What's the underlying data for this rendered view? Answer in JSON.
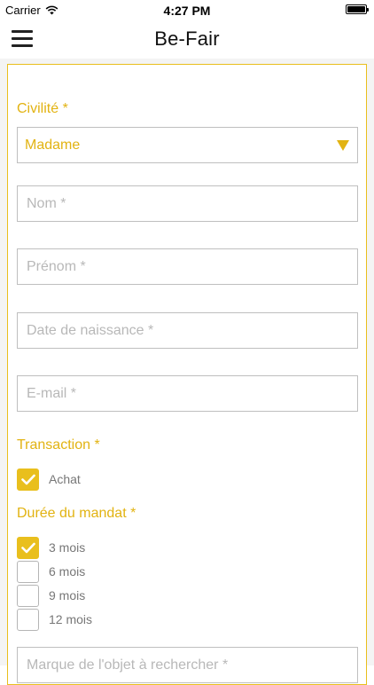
{
  "status": {
    "carrier": "Carrier",
    "time": "4:27 PM"
  },
  "nav": {
    "title": "Be-Fair",
    "menu_icon": "hamburger-icon"
  },
  "colors": {
    "accent": "#e9bf1d",
    "label": "#e2b312",
    "border": "#bfbfbf",
    "placeholder": "#b8b8b8"
  },
  "form": {
    "civilite_label": "Civilité *",
    "civilite_value": "Madame",
    "nom_placeholder": "Nom *",
    "prenom_placeholder": "Prénom *",
    "naissance_placeholder": "Date de naissance *",
    "email_placeholder": "E-mail *",
    "transaction_label": "Transaction *",
    "transaction_options": [
      {
        "label": "Achat",
        "checked": true
      }
    ],
    "duree_label": "Durée du mandat *",
    "duree_options": [
      {
        "label": "3 mois",
        "checked": true
      },
      {
        "label": "6 mois",
        "checked": false
      },
      {
        "label": "9 mois",
        "checked": false
      },
      {
        "label": "12 mois",
        "checked": false
      }
    ],
    "marque_placeholder": "Marque de l'objet à rechercher *"
  }
}
